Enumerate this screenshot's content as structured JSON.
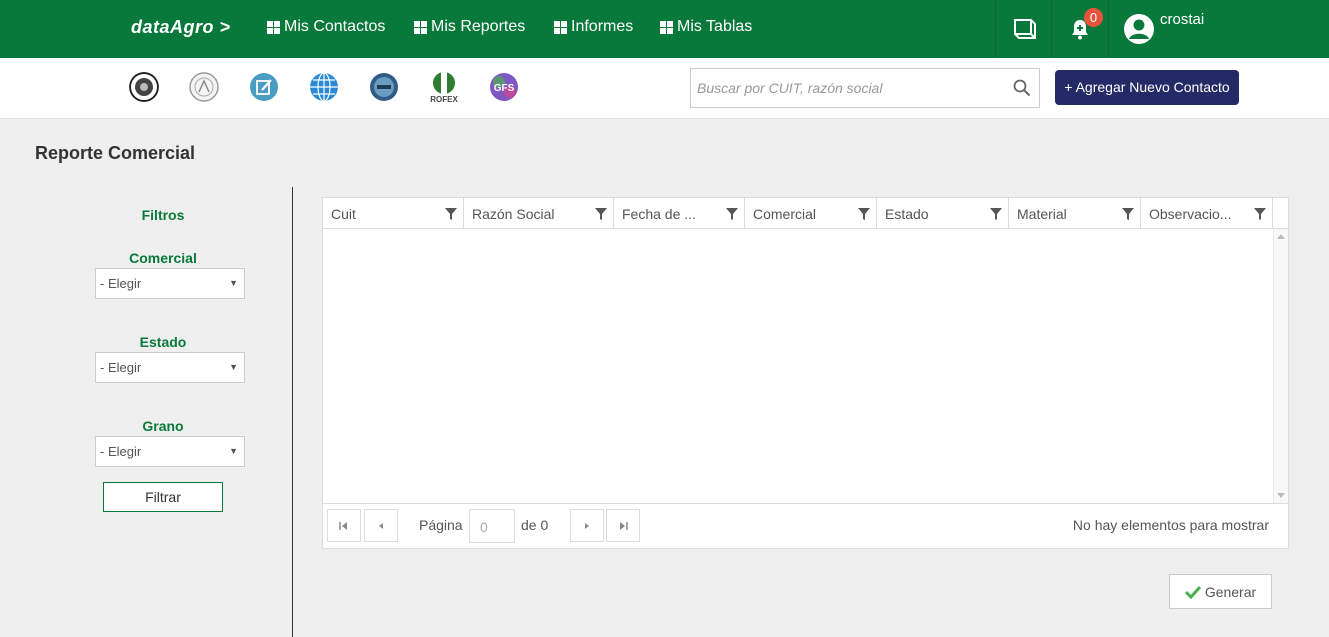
{
  "nav": {
    "brand": "dataAgro >",
    "links": [
      "Mis Contactos",
      "Mis Reportes",
      "Informes",
      "Mis Tablas"
    ],
    "notification_count": "0",
    "username": "crostai",
    "icons": [
      "book-icon",
      "bell-icon",
      "user-avatar-icon"
    ]
  },
  "subbar": {
    "logos": [
      "bolsa-cereales-logo",
      "camara-logo",
      "edit-logo",
      "globe-logo",
      "mercado-logo",
      "rofex-logo",
      "gfs-logo"
    ],
    "rofex_label": "ROFEX",
    "gfs_label": "GFS",
    "search_placeholder": "Buscar por CUIT, razón social",
    "add_button": "+ Agregar Nuevo Contacto"
  },
  "page": {
    "title": "Reporte Comercial"
  },
  "filters": {
    "title": "Filtros",
    "comercial_label": "Comercial",
    "comercial_value": "- Elegir",
    "estado_label": "Estado",
    "estado_value": "- Elegir",
    "grano_label": "Grano",
    "grano_value": "- Elegir",
    "filter_button": "Filtrar"
  },
  "grid": {
    "columns": [
      "Cuit",
      "Razón Social",
      "Fecha de ...",
      "Comercial",
      "Estado",
      "Material",
      "Observacio..."
    ],
    "pager": {
      "page_label": "Página",
      "page_value": "0",
      "of_label": "de 0",
      "info": "No hay elementos para mostrar"
    }
  },
  "actions": {
    "generate_button": "Generar"
  },
  "colors": {
    "nav_green": "#08793a",
    "add_button_navy": "#232a66",
    "badge_red": "#e8543b"
  }
}
